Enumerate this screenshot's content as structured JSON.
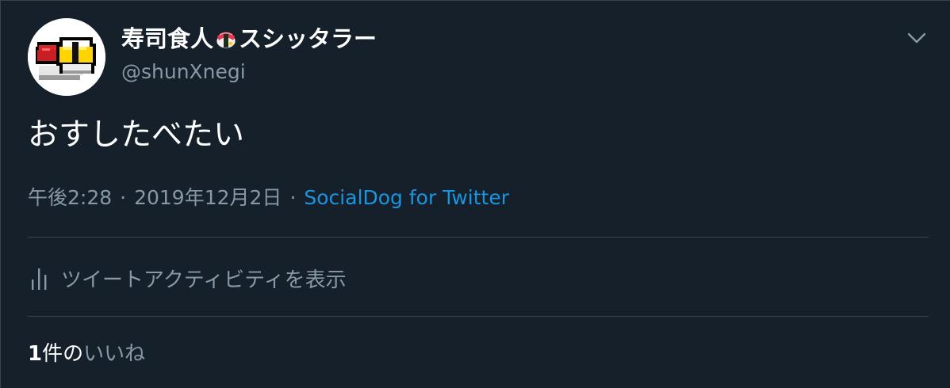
{
  "user": {
    "display_name_prefix": "寿司食人",
    "display_name_suffix": "スシッタラー",
    "handle": "@shunXnegi"
  },
  "tweet": {
    "text": "おすしたべたい",
    "time": "午後2:28",
    "date": "2019年12月2日",
    "separator": "·",
    "source": "SocialDog for Twitter"
  },
  "activity": {
    "label": "ツイートアクティビティを表示"
  },
  "likes": {
    "count": "1",
    "unit": "件の",
    "label": "いいね"
  },
  "icons": {
    "avatar": "pixel-sushi-avatar",
    "name_emoji": "sushi-roll-emoji",
    "menu": "chevron-down-icon",
    "activity": "bar-chart-icon"
  },
  "colors": {
    "background": "#15202b",
    "text": "#ffffff",
    "secondary": "#8899a6",
    "link": "#1b95e0",
    "divider": "#38444d"
  }
}
